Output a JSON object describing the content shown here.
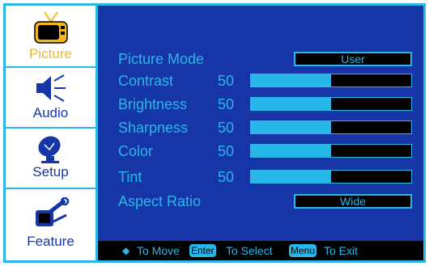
{
  "sidebar": {
    "items": [
      {
        "label": "Picture",
        "icon": "tv-icon"
      },
      {
        "label": "Audio",
        "icon": "speaker-icon"
      },
      {
        "label": "Setup",
        "icon": "satellite-dish-icon"
      },
      {
        "label": "Feature",
        "icon": "tools-icon"
      }
    ]
  },
  "menu": {
    "picture_mode": {
      "label": "Picture Mode",
      "value": "User"
    },
    "contrast": {
      "label": "Contrast",
      "value": "50",
      "level": 0.5
    },
    "brightness": {
      "label": "Brightness",
      "value": "50",
      "level": 0.5
    },
    "sharpness": {
      "label": "Sharpness",
      "value": "50",
      "level": 0.5
    },
    "color": {
      "label": "Color",
      "value": "50",
      "level": 0.5
    },
    "tint": {
      "label": "Tint",
      "value": "50",
      "level": 0.5
    },
    "aspect_ratio": {
      "label": "Aspect Ratio",
      "value": "Wide"
    }
  },
  "footer": {
    "move_text": "To Move",
    "enter_key": "Enter",
    "select_text": "To Select",
    "menu_key": "Menu",
    "exit_text": "To Exit"
  },
  "colors": {
    "accent": "#29b6e8",
    "panel": "#1636a8",
    "selected": "#f4b81c"
  }
}
